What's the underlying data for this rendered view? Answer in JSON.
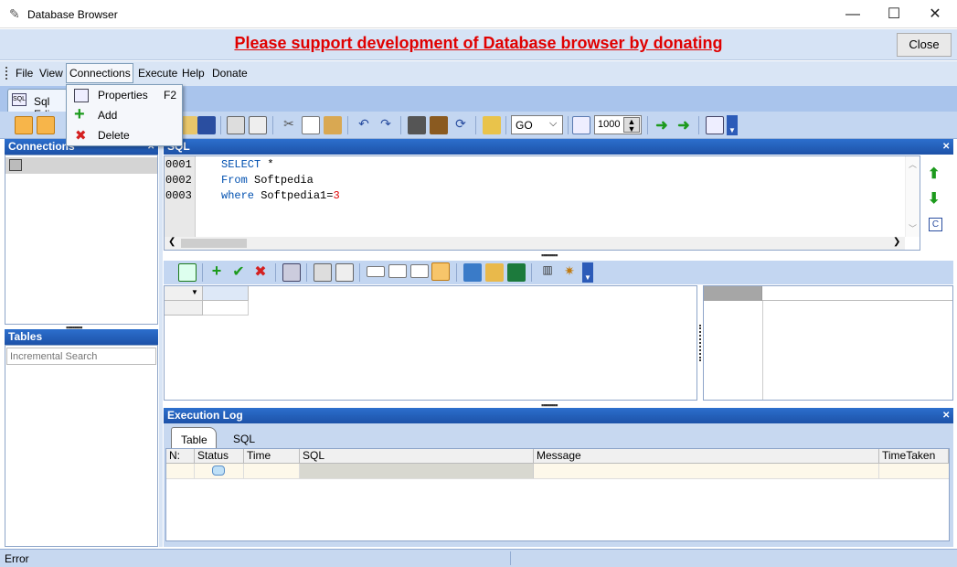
{
  "window": {
    "title": "Database Browser",
    "minimize": "—",
    "maximize": "☐",
    "close": "✕"
  },
  "donate": {
    "text": "Please support development of Database browser by donating",
    "close_label": "Close"
  },
  "menu": {
    "file": "File",
    "view": "View",
    "connections": "Connections",
    "execute": "Execute",
    "help": "Help",
    "donate": "Donate"
  },
  "dropdown": {
    "properties": "Properties",
    "properties_key": "F2",
    "add": "Add",
    "delete": "Delete"
  },
  "tabs": {
    "sql_editor": "Sql Edi"
  },
  "toolbar": {
    "go_value": "GO",
    "limit_value": "1000"
  },
  "panels": {
    "connections": "Connections",
    "tables": "Tables",
    "tables_search_placeholder": "Incremental Search",
    "sql": "SQL",
    "execution_log": "Execution Log"
  },
  "editor": {
    "lines": [
      {
        "num": "0001",
        "kw": "SELECT",
        "rest": " *",
        "val": ""
      },
      {
        "num": "0002",
        "kw": "From",
        "rest": " Softpedia",
        "val": ""
      },
      {
        "num": "0003",
        "kw": "where",
        "rest": " Softpedia1=",
        "val": "3"
      }
    ]
  },
  "log": {
    "tabs": [
      "Table",
      "SQL"
    ],
    "columns": [
      "N:",
      "Status",
      "Time",
      "SQL",
      "Message",
      "TimeTaken"
    ]
  },
  "status": {
    "text": "Error"
  },
  "colors": {
    "accent": "#1d52a8",
    "donate": "#e00000",
    "menubar": "#d9e5f5",
    "toolbar": "#c3d6f1"
  }
}
